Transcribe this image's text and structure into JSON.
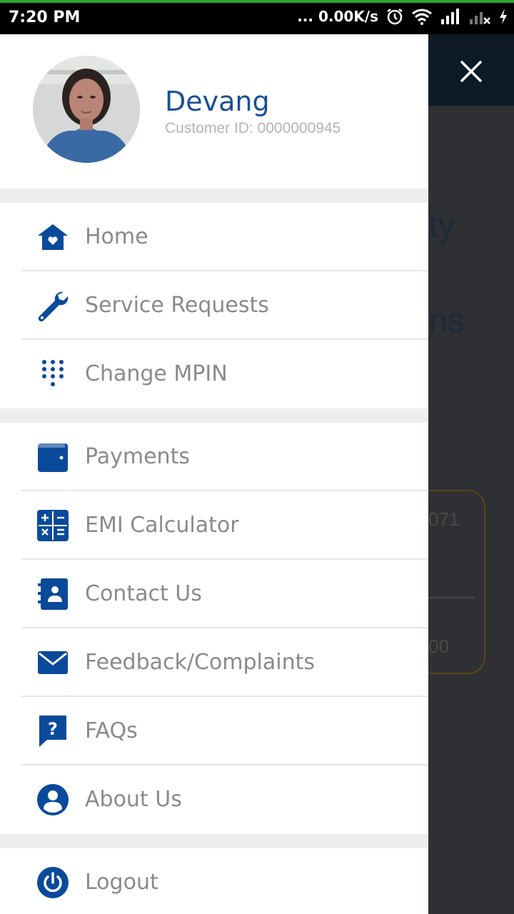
{
  "status_bar": {
    "time": "7:20 PM",
    "network_speed": "... 0.00K/s",
    "icons": [
      "alarm-icon",
      "wifi-icon",
      "signal-icon",
      "signal-x-icon",
      "charging-icon"
    ]
  },
  "profile": {
    "name": "Devang",
    "customer_id": "Customer ID: 0000000945"
  },
  "menu": {
    "group1": [
      {
        "label": "Home",
        "icon": "home-heart-icon"
      },
      {
        "label": "Service Requests",
        "icon": "wrench-icon"
      },
      {
        "label": "Change MPIN",
        "icon": "dialpad-icon"
      }
    ],
    "group2": [
      {
        "label": "Payments",
        "icon": "wallet-icon"
      },
      {
        "label": "EMI Calculator",
        "icon": "calculator-icon"
      },
      {
        "label": "Contact Us",
        "icon": "contact-book-icon"
      },
      {
        "label": "Feedback/Complaints",
        "icon": "envelope-icon"
      },
      {
        "label": "FAQs",
        "icon": "question-chat-icon"
      },
      {
        "label": "About Us",
        "icon": "person-circle-icon"
      }
    ],
    "group3": [
      {
        "label": "Logout",
        "icon": "power-icon"
      }
    ]
  },
  "colors": {
    "accent": "#0a4a9a",
    "name": "#1c4f96",
    "label": "#8a8a8a",
    "separator": "#eeeeee"
  }
}
